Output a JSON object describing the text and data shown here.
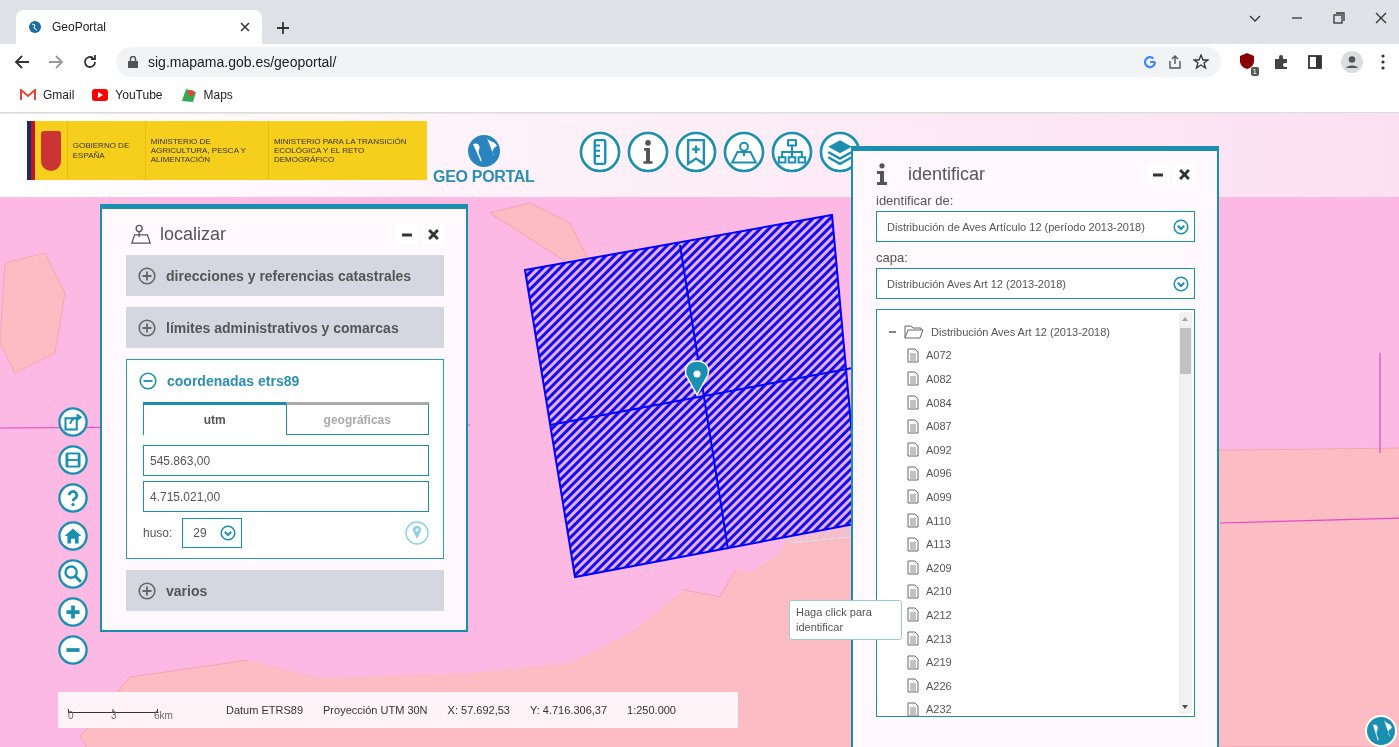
{
  "browser": {
    "tab_title": "GeoPortal",
    "url": "sig.mapama.gob.es/geoportal/",
    "extension_badge": "1",
    "bookmarks": [
      {
        "label": "Gmail",
        "kind": "gmail"
      },
      {
        "label": "YouTube",
        "kind": "youtube"
      },
      {
        "label": "Maps",
        "kind": "maps"
      }
    ]
  },
  "header": {
    "logo_texts": [
      "GOBIERNO DE ESPAÑA",
      "MINISTERIO DE AGRICULTURA, PESCA Y ALIMENTACIÓN",
      "MINISTERIO PARA LA TRANSICIÓN ECOLÓGICA Y EL RETO DEMOGRÁFICO"
    ],
    "brand": "GEO PORTAL"
  },
  "locate_panel": {
    "title": "localizar",
    "sections": [
      {
        "label": "direcciones y referencias catastrales",
        "expanded": false
      },
      {
        "label": "límites administrativos y comarcas",
        "expanded": false
      },
      {
        "label": "coordenadas etrs89",
        "expanded": true,
        "tabs": [
          {
            "label": "utm",
            "selected": true
          },
          {
            "label": "geográficas",
            "selected": false
          }
        ],
        "x_value": "545.863,00",
        "y_value": "4.715.021,00",
        "zone_label": "huso:",
        "zone_value": "29"
      },
      {
        "label": "varios",
        "expanded": false
      }
    ]
  },
  "identify_panel": {
    "title": "identificar",
    "source_label": "identificar de:",
    "source_value": "Distribución de Aves Artículo 12 (período 2013-2018)",
    "layer_label": "capa:",
    "layer_value": "Distribución Aves Art 12 (2013-2018)",
    "tree": [
      {
        "label": "Distribución Aves Art 12 (2013-2018)",
        "expanded": true,
        "children": [
          {
            "label": "A072"
          },
          {
            "label": "A082"
          },
          {
            "label": "A084"
          },
          {
            "label": "A087"
          },
          {
            "label": "A092"
          },
          {
            "label": "A096"
          },
          {
            "label": "A099"
          },
          {
            "label": "A110"
          },
          {
            "label": "A113"
          },
          {
            "label": "A209"
          },
          {
            "label": "A210"
          },
          {
            "label": "A212"
          },
          {
            "label": "A213"
          },
          {
            "label": "A219"
          },
          {
            "label": "A226"
          },
          {
            "label": "A232"
          }
        ]
      }
    ]
  },
  "tooltip": "Haga click para identificar",
  "status_bar": {
    "scale_ticks": [
      "0",
      "3",
      "6km"
    ],
    "datum": "Datum ETRS89",
    "projection": "Proyección UTM 30N",
    "x": "X: 57.692,53",
    "y": "Y: 4.716.306,37",
    "scale": "1:250.000"
  }
}
